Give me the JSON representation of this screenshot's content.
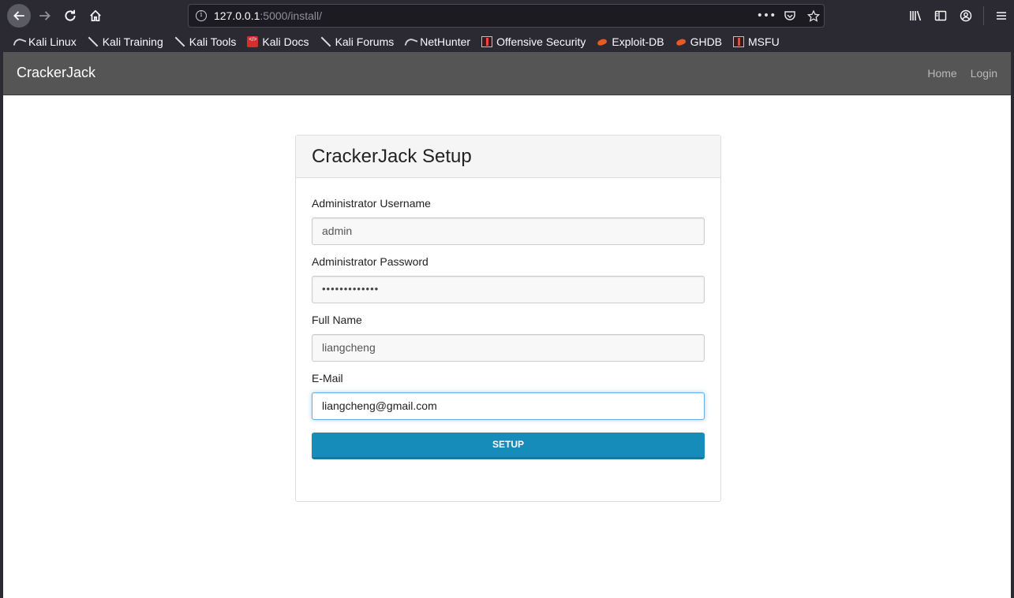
{
  "browser": {
    "url_host": "127.0.0.1",
    "url_rest": ":5000/install/",
    "bookmarks": [
      {
        "label": "Kali Linux",
        "icon": "kali-dragon-icon"
      },
      {
        "label": "Kali Training",
        "icon": "kali-slash-icon"
      },
      {
        "label": "Kali Tools",
        "icon": "kali-slash-icon"
      },
      {
        "label": "Kali Docs",
        "icon": "kali-docs-icon"
      },
      {
        "label": "Kali Forums",
        "icon": "kali-slash-icon"
      },
      {
        "label": "NetHunter",
        "icon": "kali-dragon-icon"
      },
      {
        "label": "Offensive Security",
        "icon": "offsec-icon"
      },
      {
        "label": "Exploit-DB",
        "icon": "exploit-db-icon"
      },
      {
        "label": "GHDB",
        "icon": "exploit-db-icon"
      },
      {
        "label": "MSFU",
        "icon": "offsec-icon"
      }
    ]
  },
  "app": {
    "brand": "CrackerJack",
    "nav": [
      "Home",
      "Login"
    ]
  },
  "setup": {
    "title": "CrackerJack Setup",
    "fields": {
      "username": {
        "label": "Administrator Username",
        "value": "admin"
      },
      "password": {
        "label": "Administrator Password",
        "value": "•••••••••••••"
      },
      "fullname": {
        "label": "Full Name",
        "value": "liangcheng"
      },
      "email": {
        "label": "E-Mail",
        "value": "liangcheng@gmail.com"
      }
    },
    "submit_label": "SETUP"
  },
  "colors": {
    "navbar": "#555555",
    "button": "#158cba",
    "focus_border": "#66afe9"
  }
}
